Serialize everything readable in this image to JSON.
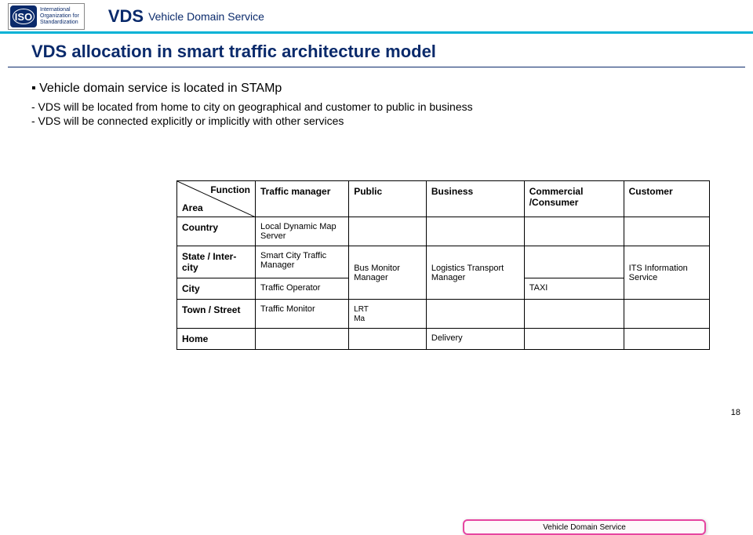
{
  "header": {
    "iso_logo_text": "ISO",
    "iso_line1": "International",
    "iso_line2": "Organization for",
    "iso_line3": "Standardization",
    "vds": "VDS",
    "vds_full": "Vehicle Domain Service"
  },
  "title": "VDS allocation in smart traffic architecture model",
  "bullet_main": "Vehicle domain service is located in STAMp",
  "bullet_sub1": "- VDS will be located from home to city on geographical and customer to public in business",
  "bullet_sub2": "- VDS will be connected explicitly or implicitly with other services",
  "table": {
    "corner_function": "Function",
    "corner_area": "Area",
    "cols": [
      "Traffic manager",
      "Public",
      "Business",
      "Commercial /Consumer",
      "Customer"
    ],
    "rows": [
      "Country",
      "State / Inter-city",
      "City",
      "Town / Street",
      "Home"
    ],
    "cells": {
      "r0c0": "Local Dynamic Map Server",
      "r1c0": "Smart City Traffic Manager",
      "r1c1": "Bus Monitor Manager",
      "r1c2": "Logistics Transport Manager",
      "r1c4": "ITS Information Service",
      "r2c0": "Traffic Operator",
      "r2c3": "TAXI",
      "r3c0": "Traffic Monitor",
      "r3c1_prefix": "LRT",
      "r3c1_suffix": "Ma",
      "r4c2": "Delivery"
    }
  },
  "overlay_vds": "Vehicle Domain Service",
  "page_number": "18"
}
